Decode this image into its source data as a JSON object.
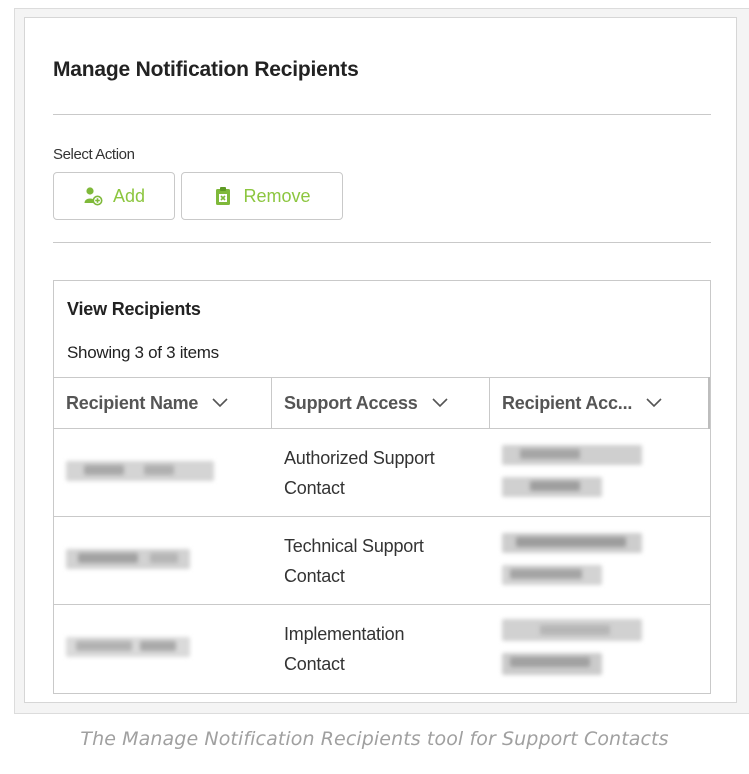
{
  "panel": {
    "title": "Manage Notification Recipients",
    "select_action_label": "Select Action",
    "buttons": {
      "add": {
        "label": "Add",
        "icon": "add-user-icon"
      },
      "remove": {
        "label": "Remove",
        "icon": "clipboard-remove-icon"
      }
    },
    "accent_color": "#8cc63f"
  },
  "grid": {
    "title": "View Recipients",
    "count_text": "Showing 3 of 3 items",
    "columns": [
      {
        "label": "Recipient Name",
        "icon": "chevron-down-icon"
      },
      {
        "label": "Support Access",
        "icon": "chevron-down-icon"
      },
      {
        "label": "Recipient Acc...",
        "icon": "chevron-down-icon"
      }
    ],
    "rows": [
      {
        "support_access_line1": "Authorized Support",
        "support_access_line2": "Contact"
      },
      {
        "support_access_line1": "Technical Support",
        "support_access_line2": "Contact"
      },
      {
        "support_access_line1": "Implementation",
        "support_access_line2": "Contact"
      }
    ]
  },
  "caption": "The Manage Notification Recipients tool for Support Contacts"
}
